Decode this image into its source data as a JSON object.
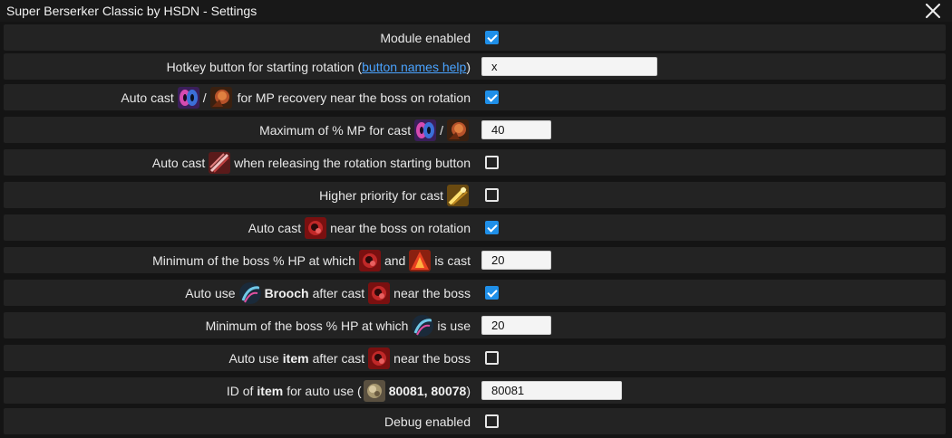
{
  "window": {
    "title": "Super Berserker Classic by HSDN - Settings"
  },
  "rows": {
    "r0": {
      "label": "Module enabled",
      "checked": true
    },
    "r1": {
      "pre": "Hotkey button for starting rotation (",
      "link": "button names help",
      "post": ")",
      "value": "x"
    },
    "r2": {
      "pre": "Auto cast",
      "sep": "/",
      "post": "for MP recovery near the boss on rotation",
      "checked": true
    },
    "r3": {
      "pre": "Maximum of % MP for cast",
      "sep": "/",
      "value": "40"
    },
    "r4": {
      "pre": "Auto cast",
      "post": "when releasing the rotation starting button",
      "checked": false
    },
    "r5": {
      "pre": "Higher priority for cast",
      "checked": false
    },
    "r6": {
      "pre": "Auto cast",
      "post": "near the boss on rotation",
      "checked": true
    },
    "r7": {
      "pre": "Minimum of the boss % HP at which",
      "mid": "and",
      "post": "is cast",
      "value": "20"
    },
    "r8": {
      "pre": "Auto use",
      "bold": "Brooch",
      "mid": "after cast",
      "post": "near the boss",
      "checked": true
    },
    "r9": {
      "pre": "Minimum of the boss % HP at which",
      "post": "is use",
      "value": "20"
    },
    "r10": {
      "pre": "Auto use",
      "bold": "item",
      "mid": "after cast",
      "post": "near the boss",
      "checked": false
    },
    "r11": {
      "pre": "ID of",
      "bold": "item",
      "mid": "for auto use (",
      "bold2": "80081, 80078",
      "post": ")",
      "value": "80081"
    },
    "r12": {
      "label": "Debug enabled",
      "checked": false
    }
  },
  "icons": {
    "mp_mask": "mask-icon",
    "mp_fire": "flame-head-icon",
    "slash": "slash-icon",
    "gold": "golden-blade-icon",
    "berserk": "red-beast-icon",
    "berserk2": "red-fury-icon",
    "brooch": "brooch-icon",
    "item": "item-icon"
  }
}
